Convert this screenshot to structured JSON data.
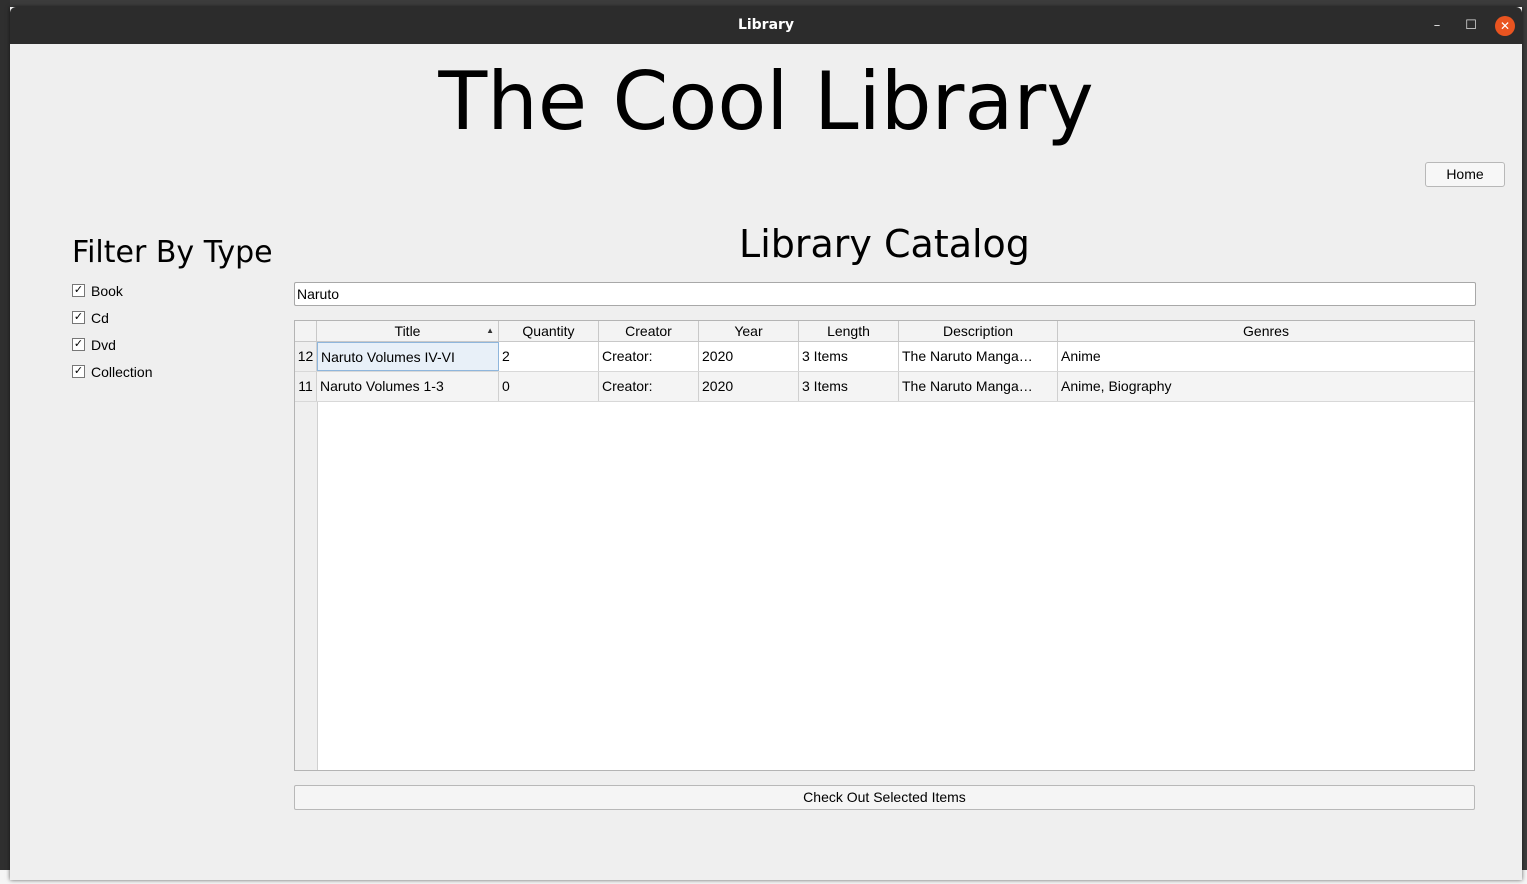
{
  "window": {
    "title": "Library",
    "min_icon": "minimize-icon",
    "max_icon": "maximize-icon",
    "close_icon": "close-icon"
  },
  "app": {
    "heading": "The Cool Library",
    "home_label": "Home"
  },
  "filter": {
    "title": "Filter By Type",
    "items": [
      {
        "label": "Book",
        "checked": true
      },
      {
        "label": "Cd",
        "checked": true
      },
      {
        "label": "Dvd",
        "checked": true
      },
      {
        "label": "Collection",
        "checked": true
      }
    ]
  },
  "catalog": {
    "title": "Library Catalog",
    "search_value": "Naruto",
    "columns": [
      "Title",
      "Quantity",
      "Creator",
      "Year",
      "Length",
      "Description",
      "Genres"
    ],
    "sort_column": "Title",
    "rows": [
      {
        "id": "12",
        "cells": [
          "Naruto Volumes IV-VI",
          "2",
          "Creator:",
          "2020",
          "3 Items",
          "The Naruto Manga…",
          "Anime"
        ]
      },
      {
        "id": "11",
        "cells": [
          "Naruto Volumes 1-3",
          "0",
          "Creator:",
          "2020",
          "3 Items",
          "The Naruto Manga…",
          "Anime, Biography"
        ]
      }
    ],
    "checkout_label": "Check Out Selected Items"
  },
  "colors": {
    "titlebar": "#2c2c2c",
    "close_button": "#e95420",
    "window_bg": "#efefef"
  }
}
